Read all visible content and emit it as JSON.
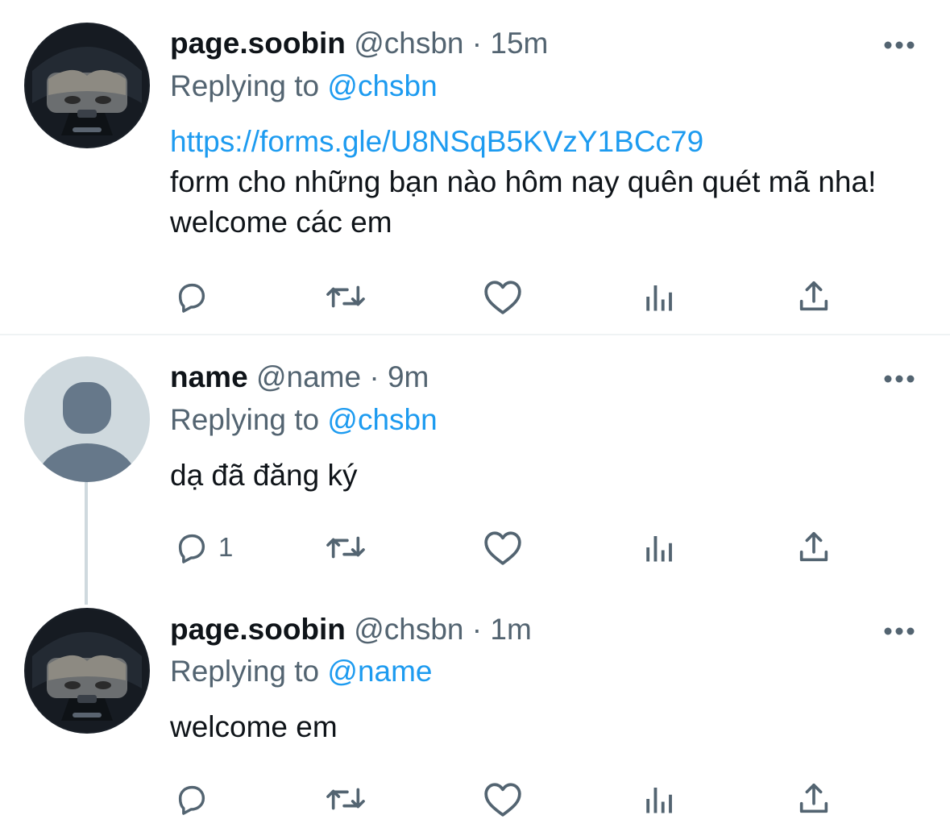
{
  "tweets": [
    {
      "display_name": "page.soobin",
      "handle": "@chsbn",
      "separator": "·",
      "time": "15m",
      "replying_prefix": "Replying to",
      "replying_to": "@chsbn",
      "link": "https://forms.gle/U8NSqB5KVzY1BCc79",
      "body": "form cho những bạn nào hôm nay quên quét mã nha! welcome các em",
      "reply_count": ""
    },
    {
      "display_name": "name",
      "handle": "@name",
      "separator": "·",
      "time": "9m",
      "replying_prefix": "Replying to",
      "replying_to": "@chsbn",
      "body": "dạ đã đăng ký",
      "reply_count": "1"
    },
    {
      "display_name": "page.soobin",
      "handle": "@chsbn",
      "separator": "·",
      "time": "1m",
      "replying_prefix": "Replying to",
      "replying_to": "@name",
      "body": "welcome em",
      "reply_count": ""
    }
  ],
  "icons": {
    "more": "more-horizontal-icon",
    "reply": "reply-icon",
    "retweet": "retweet-icon",
    "like": "heart-icon",
    "analytics": "analytics-icon",
    "share": "share-icon"
  },
  "colors": {
    "text": "#0f1419",
    "muted": "#536471",
    "link": "#1d9bf0",
    "divider": "#eff3f4",
    "thread_line": "#cfd9de"
  }
}
